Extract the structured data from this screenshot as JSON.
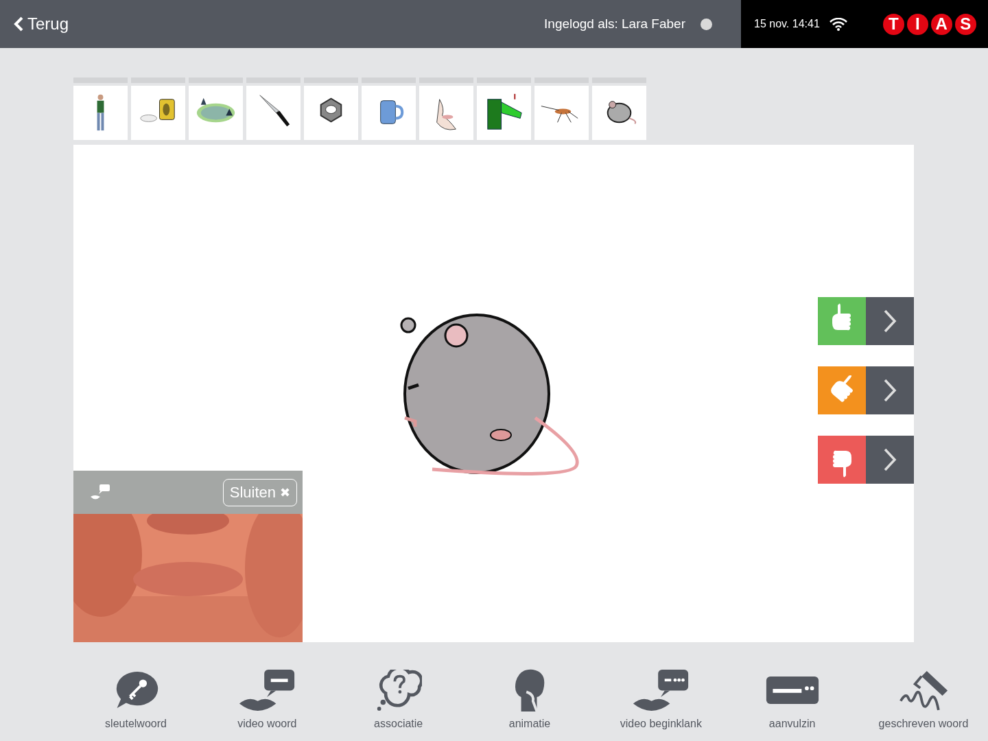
{
  "header": {
    "back_label": "Terug",
    "user_label": "Ingelogd als: Lara Faber",
    "clock": "15 nov. 14:41",
    "logo_letters": [
      "T",
      "I",
      "A",
      "S"
    ]
  },
  "thumbnails": [
    {
      "kind": "person"
    },
    {
      "kind": "bag"
    },
    {
      "kind": "pond"
    },
    {
      "kind": "knife"
    },
    {
      "kind": "nut"
    },
    {
      "kind": "mug"
    },
    {
      "kind": "nose"
    },
    {
      "kind": "pipe"
    },
    {
      "kind": "insect"
    },
    {
      "kind": "mouse"
    }
  ],
  "ratings": [
    {
      "kind": "up",
      "color": "#62c05a"
    },
    {
      "kind": "side",
      "color": "#f3911e"
    },
    {
      "kind": "down",
      "color": "#ec5a58"
    }
  ],
  "video_panel": {
    "close_label": "Sluiten",
    "close_glyph": "✖"
  },
  "toolbar": [
    {
      "kind": "key",
      "label": "sleutelwoord"
    },
    {
      "kind": "lips",
      "label": "video woord"
    },
    {
      "kind": "cloud",
      "label": "associatie"
    },
    {
      "kind": "head",
      "label": "animatie"
    },
    {
      "kind": "lipsdots",
      "label": "video beginklank"
    },
    {
      "kind": "bar",
      "label": "aanvulzin"
    },
    {
      "kind": "pen",
      "label": "geschreven woord"
    }
  ]
}
